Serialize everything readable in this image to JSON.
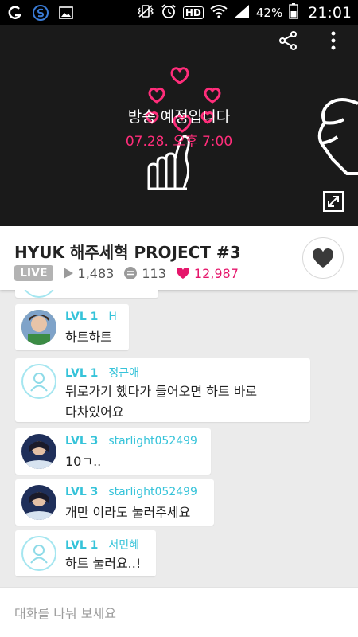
{
  "status_bar": {
    "battery": "42%",
    "time": "21:01",
    "hd_badge": "HD",
    "icons": [
      "app-icon-g",
      "app-icon-s",
      "gallery-icon",
      "vibrate-icon",
      "alarm-icon",
      "hd-icon",
      "wifi-icon",
      "signal-icon",
      "battery-icon"
    ]
  },
  "video": {
    "notice": "방송 예정입니다",
    "notice_time": "07.28. 오후 7:00",
    "icons": [
      "share-icon",
      "more-icon",
      "expand-icon"
    ]
  },
  "broadcast": {
    "title": "HYUK 해주세혁 PROJECT #3",
    "live_badge": "LIVE",
    "views": "1,483",
    "comments": "113",
    "likes": "12,987"
  },
  "chat": {
    "messages": [
      {
        "level": "LVL 1",
        "user": "H",
        "text_lines": [
          "하트하트"
        ]
      },
      {
        "level": "LVL 1",
        "user": "정근애",
        "text_lines": [
          "뒤로가기 했다가 들어오면 하트 바로",
          "다차있어요"
        ]
      },
      {
        "level": "LVL 3",
        "user": "starlight052499",
        "text_lines": [
          "10ㄱ.."
        ]
      },
      {
        "level": "LVL 3",
        "user": "starlight052499",
        "text_lines": [
          "개만 이라도 눌러주세요"
        ]
      },
      {
        "level": "LVL 1",
        "user": "서민혜",
        "text_lines": [
          "하트 눌러요..!"
        ]
      }
    ]
  },
  "input": {
    "placeholder": "대화를 나눠 보세요"
  },
  "colors": {
    "accent_cyan": "#36c3d9",
    "like_pink": "#e5166b",
    "neon_pink": "#ff2d7a"
  }
}
